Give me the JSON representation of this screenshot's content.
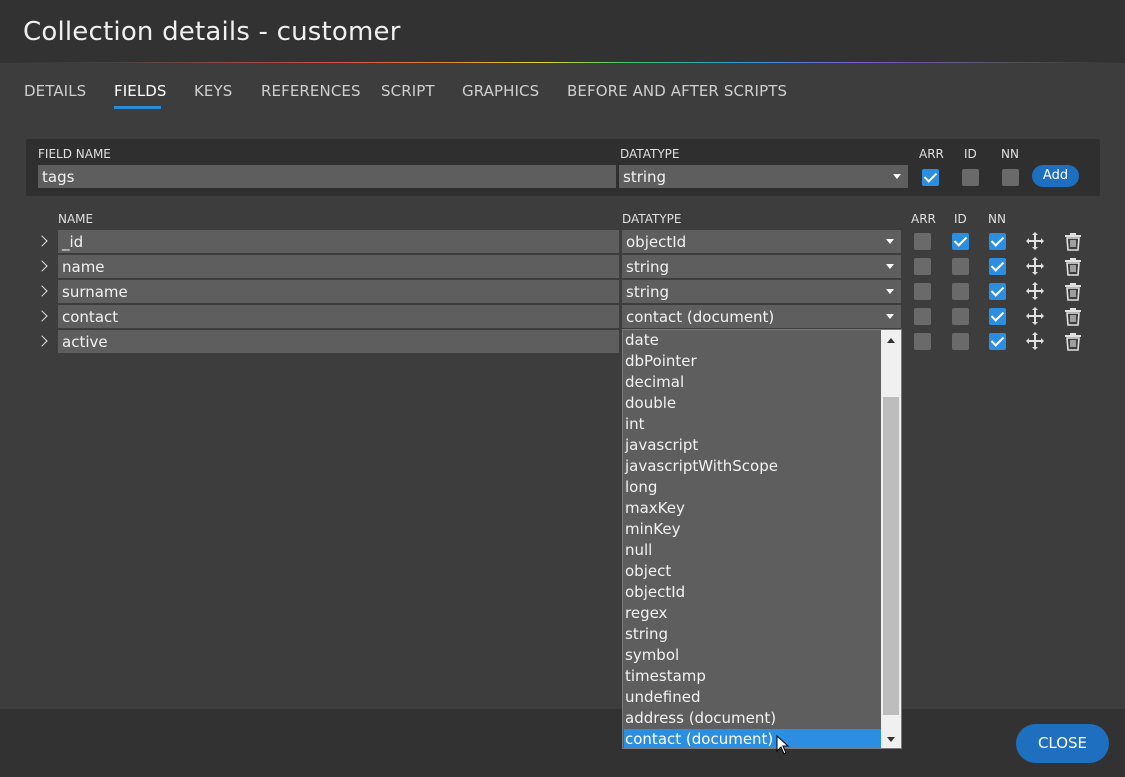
{
  "window": {
    "title": "Collection details - customer"
  },
  "tabs": [
    {
      "label": "DETAILS"
    },
    {
      "label": "FIELDS"
    },
    {
      "label": "KEYS"
    },
    {
      "label": "REFERENCES"
    },
    {
      "label": "SCRIPT"
    },
    {
      "label": "GRAPHICS"
    },
    {
      "label": "BEFORE AND AFTER SCRIPTS"
    }
  ],
  "active_tab": "FIELDS",
  "add_field": {
    "headers": {
      "field_name": "FIELD NAME",
      "datatype": "DATATYPE",
      "arr": "ARR",
      "id": "ID",
      "nn": "NN"
    },
    "name_value": "tags",
    "datatype_value": "string",
    "arr": true,
    "id": false,
    "nn": false,
    "add_label": "Add"
  },
  "fields_table": {
    "headers": {
      "name": "NAME",
      "datatype": "DATATYPE",
      "arr": "ARR",
      "id": "ID",
      "nn": "NN"
    },
    "rows": [
      {
        "name": "_id",
        "datatype": "objectId",
        "arr": false,
        "id": true,
        "nn": true
      },
      {
        "name": "name",
        "datatype": "string",
        "arr": false,
        "id": false,
        "nn": true
      },
      {
        "name": "surname",
        "datatype": "string",
        "arr": false,
        "id": false,
        "nn": true
      },
      {
        "name": "contact",
        "datatype": "contact (document)",
        "arr": false,
        "id": false,
        "nn": true
      },
      {
        "name": "active",
        "datatype": "",
        "arr": false,
        "id": false,
        "nn": true
      }
    ]
  },
  "datatype_dropdown": {
    "options": [
      "date",
      "dbPointer",
      "decimal",
      "double",
      "int",
      "javascript",
      "javascriptWithScope",
      "long",
      "maxKey",
      "minKey",
      "null",
      "object",
      "objectId",
      "regex",
      "string",
      "symbol",
      "timestamp",
      "undefined",
      "address (document)",
      "contact (document)"
    ],
    "selected": "contact (document)"
  },
  "icons": {
    "expand": "chevron-right-icon",
    "move": "move-arrows-icon",
    "delete": "trash-icon"
  },
  "colors": {
    "accent": "#2b8ee0",
    "button": "#1e6fbf"
  },
  "footer": {
    "close_label": "CLOSE"
  }
}
